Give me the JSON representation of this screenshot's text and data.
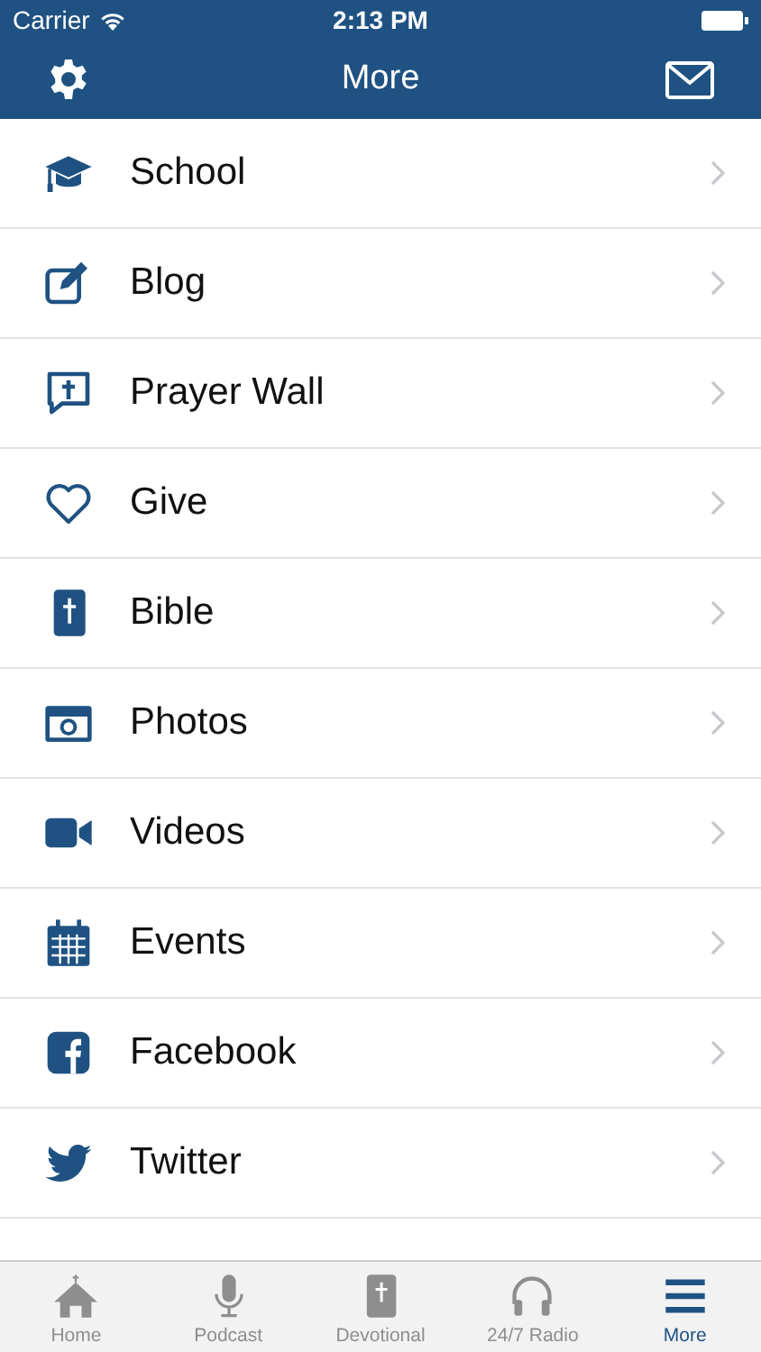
{
  "status_bar": {
    "carrier": "Carrier",
    "time": "2:13 PM"
  },
  "nav_bar": {
    "title": "More"
  },
  "items": [
    {
      "kind": "school",
      "label": "School"
    },
    {
      "kind": "blog",
      "label": "Blog"
    },
    {
      "kind": "prayer",
      "label": "Prayer Wall"
    },
    {
      "kind": "give",
      "label": "Give"
    },
    {
      "kind": "bible",
      "label": "Bible"
    },
    {
      "kind": "photos",
      "label": "Photos"
    },
    {
      "kind": "videos",
      "label": "Videos"
    },
    {
      "kind": "events",
      "label": "Events"
    },
    {
      "kind": "facebook",
      "label": "Facebook"
    },
    {
      "kind": "twitter",
      "label": "Twitter"
    }
  ],
  "tab_bar": [
    {
      "kind": "home",
      "label": "Home",
      "selected": false
    },
    {
      "kind": "podcast",
      "label": "Podcast",
      "selected": false
    },
    {
      "kind": "devotional",
      "label": "Devotional",
      "selected": false
    },
    {
      "kind": "radio",
      "label": "24/7 Radio",
      "selected": false
    },
    {
      "kind": "more",
      "label": "More",
      "selected": true
    }
  ]
}
